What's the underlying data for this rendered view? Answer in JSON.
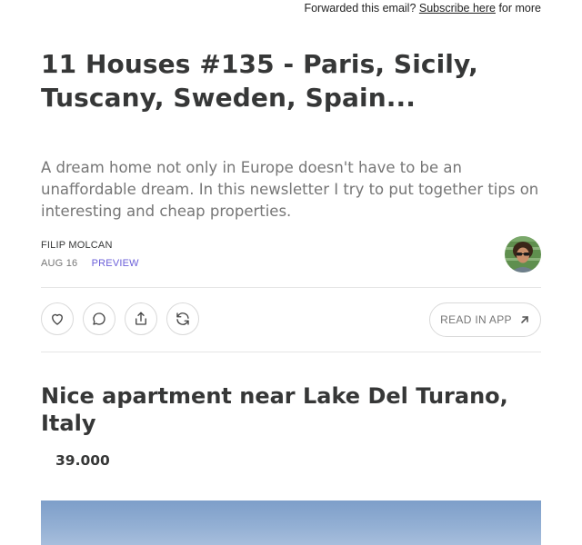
{
  "forward_bar": {
    "prefix": "Forwarded this email?",
    "link": "Subscribe here",
    "suffix": "for more"
  },
  "post": {
    "title": "11 Houses #135 - Paris, Sicily, Tuscany, Sweden, Spain...",
    "subtitle": "A dream home not only in Europe doesn't have to be an unaffordable dream. In this newsletter I try to put together tips on interesting and cheap properties.",
    "author": "FILIP MOLCAN",
    "date": "AUG 16",
    "preview_label": "PREVIEW"
  },
  "actions": {
    "like_icon": "heart-icon",
    "comment_icon": "comment-icon",
    "share_icon": "share-icon",
    "restack_icon": "restack-icon",
    "read_in_app_label": "READ IN APP",
    "read_in_app_icon": "arrow-up-right-icon"
  },
  "section": {
    "title": "Nice apartment near Lake Del Turano, Italy",
    "price": "39.000"
  },
  "colors": {
    "text": "#363737",
    "muted": "#767676",
    "accent": "#6b5fd9",
    "border": "#d9d9d9"
  }
}
